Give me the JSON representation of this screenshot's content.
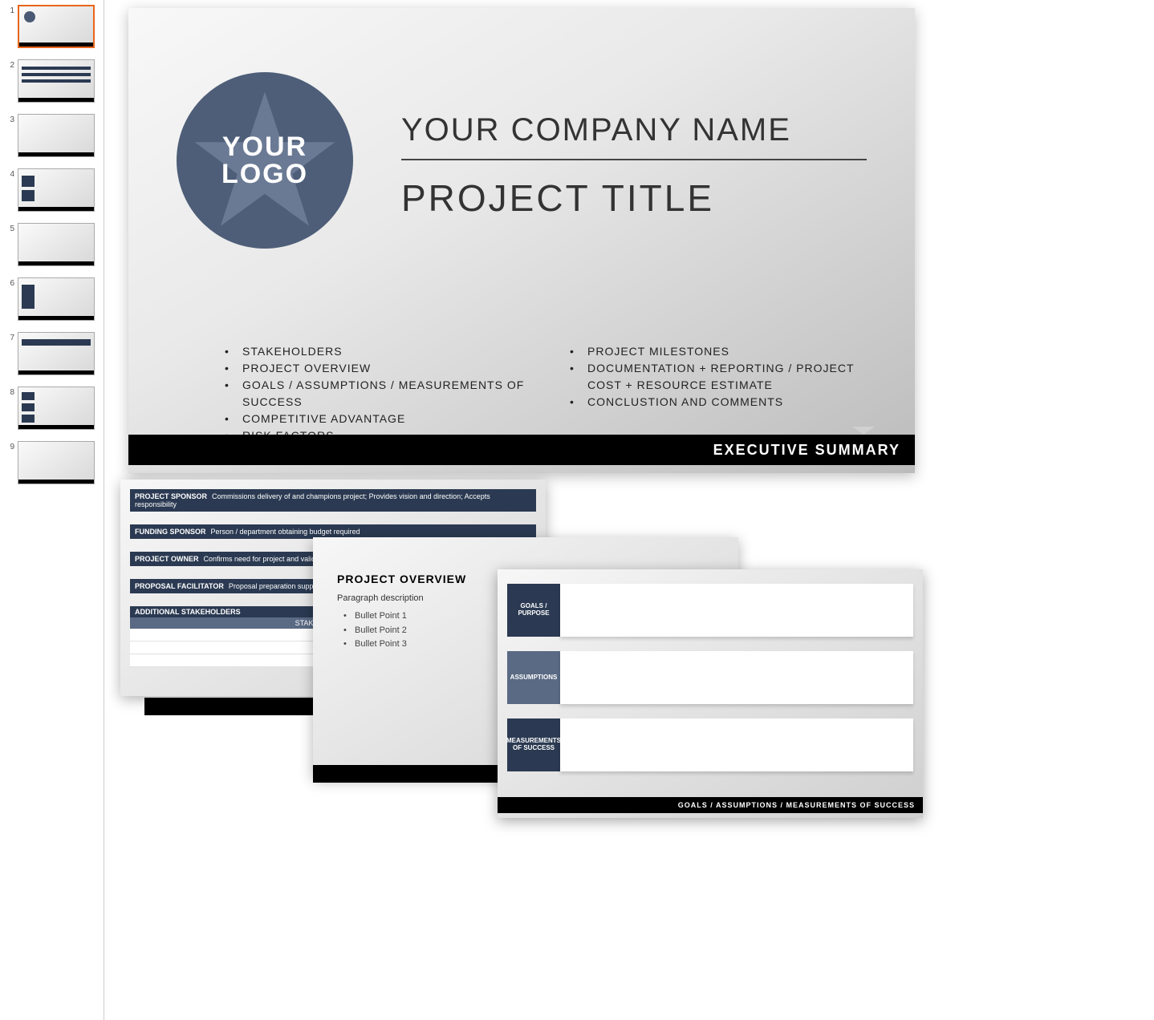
{
  "thumbnails": [
    "1",
    "2",
    "3",
    "4",
    "5",
    "6",
    "7",
    "8",
    "9"
  ],
  "main": {
    "logo_line1": "YOUR",
    "logo_line2": "LOGO",
    "company": "YOUR COMPANY NAME",
    "title": "PROJECT TITLE",
    "bullets_left": [
      "STAKEHOLDERS",
      "PROJECT OVERVIEW",
      "GOALS / ASSUMPTIONS / MEASUREMENTS OF SUCCESS",
      "COMPETITIVE ADVANTAGE",
      "RISK FACTORS"
    ],
    "bullets_right": [
      "PROJECT MILESTONES",
      "DOCUMENTATION + REPORTING / PROJECT COST + RESOURCE ESTIMATE",
      "CONCLUSTION AND COMMENTS"
    ],
    "footer": "EXECUTIVE SUMMARY"
  },
  "card1": {
    "rows": [
      {
        "label": "PROJECT SPONSOR",
        "desc": "Commissions delivery of and champions project; Provides vision and direction; Accepts responsibility"
      },
      {
        "label": "FUNDING SPONSOR",
        "desc": "Person / department obtaining budget required"
      },
      {
        "label": "PROJECT OWNER",
        "desc": "Confirms need for project and validates objectives"
      },
      {
        "label": "PROPOSAL FACILITATOR",
        "desc": "Proposal preparation support"
      }
    ],
    "section_header": "ADDITIONAL STAKEHOLDERS",
    "sub_header": "STAKEHOLDER NAME"
  },
  "card2": {
    "heading": "PROJECT OVERVIEW",
    "para": "Paragraph description",
    "bullets": [
      "Bullet Point 1",
      "Bullet Point 2",
      "Bullet Point 3"
    ]
  },
  "card3": {
    "blocks": [
      {
        "label": "GOALS / PURPOSE",
        "style": "dark"
      },
      {
        "label": "ASSUMPTIONS",
        "style": "light"
      },
      {
        "label": "MEASUREMENTS OF SUCCESS",
        "style": "dark"
      }
    ],
    "footer": "GOALS / ASSUMPTIONS / MEASUREMENTS OF SUCCESS"
  }
}
